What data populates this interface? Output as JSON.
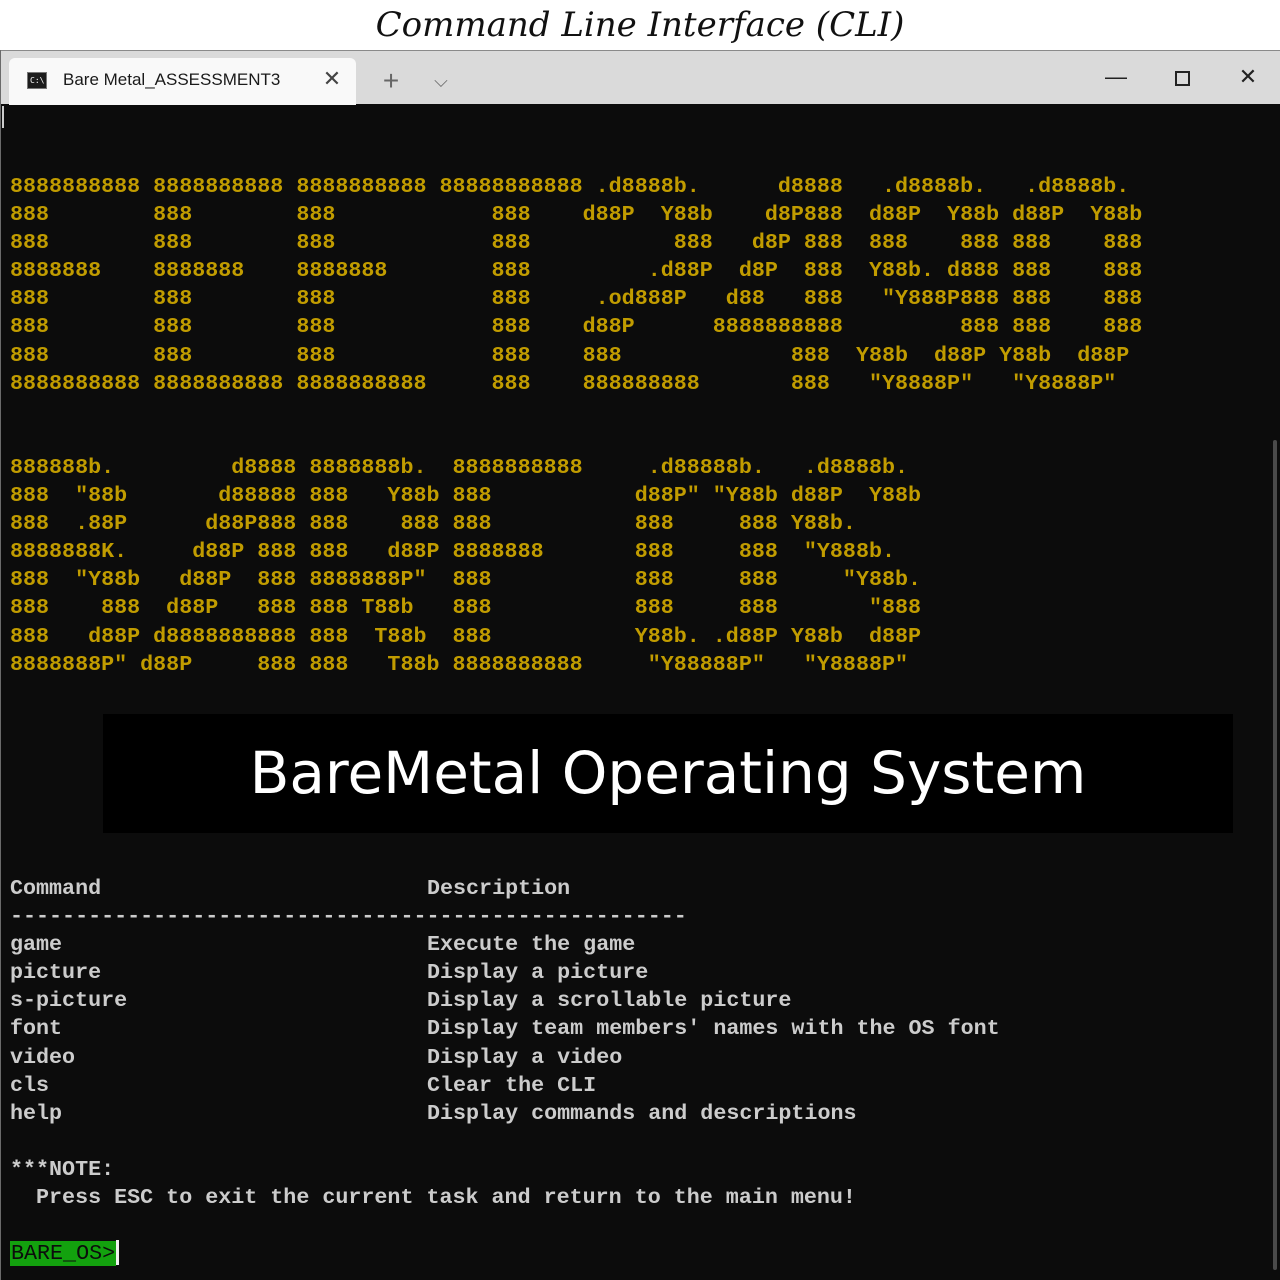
{
  "caption": "Command Line Interface (CLI)",
  "window": {
    "tab": {
      "icon": "cmd-prompt-icon",
      "icon_text": "C:\\",
      "title": "Bare Metal_ASSESSMENT3",
      "close_glyph": "✕"
    },
    "new_tab_glyph": "+",
    "dropdown_glyph": "⌵",
    "controls": {
      "minimize_glyph": "—",
      "close_glyph": "✕"
    }
  },
  "terminal": {
    "banner_color": "#c19c00",
    "banner_line1": [
      "8888888888 8888888888 8888888888 88888888888 .d8888b.      d8888   .d8888b.   .d8888b.",
      "888        888        888            888    d88P  Y88b    d8P888  d88P  Y88b d88P  Y88b",
      "888        888        888            888           888   d8P 888  888    888 888    888",
      "8888888    8888888    8888888        888         .d88P  d8P  888  Y88b. d888 888    888",
      "888        888        888            888     .od888P   d88   888   \"Y888P888 888    888",
      "888        888        888            888    d88P      8888888888         888 888    888",
      "888        888        888            888    888             888  Y88b  d88P Y88b  d88P",
      "8888888888 8888888888 8888888888     888    888888888       888   \"Y8888P\"   \"Y8888P\""
    ],
    "banner_line2": [
      "888888b.         d8888 8888888b.  8888888888     .d88888b.   .d8888b.",
      "888  \"88b       d88888 888   Y88b 888           d88P\" \"Y88b d88P  Y88b",
      "888  .88P      d88P888 888    888 888           888     888 Y88b.",
      "8888888K.     d88P 888 888   d88P 8888888       888     888  \"Y888b.",
      "888  \"Y88b   d88P  888 8888888P\"  888           888     888     \"Y88b.",
      "888    888  d88P   888 888 T88b   888           888     888       \"888",
      "888   d88P d8888888888 888  T88b  888           Y88b. .d88P Y88b  d88P",
      "8888888P\" d88P     888 888   T88b 8888888888     \"Y88888P\"   \"Y8888P\""
    ],
    "os_title": "BareMetal Operating System",
    "help": {
      "header_command": "Command",
      "header_description": "Description",
      "separator": "----------------------------------------------------",
      "rows": [
        {
          "command": "game",
          "description": "Execute the game"
        },
        {
          "command": "picture",
          "description": "Display a picture"
        },
        {
          "command": "s-picture",
          "description": "Display a scrollable picture"
        },
        {
          "command": "font",
          "description": "Display team members' names with the OS font"
        },
        {
          "command": "video",
          "description": "Display a video"
        },
        {
          "command": "cls",
          "description": "Clear the CLI"
        },
        {
          "command": "help",
          "description": "Display commands and descriptions"
        }
      ]
    },
    "note_title": "***NOTE:",
    "note_text": "  Press ESC to exit the current task and return to the main menu!",
    "prompt": "BARE_OS>",
    "prompt_color": "#13a10e"
  }
}
